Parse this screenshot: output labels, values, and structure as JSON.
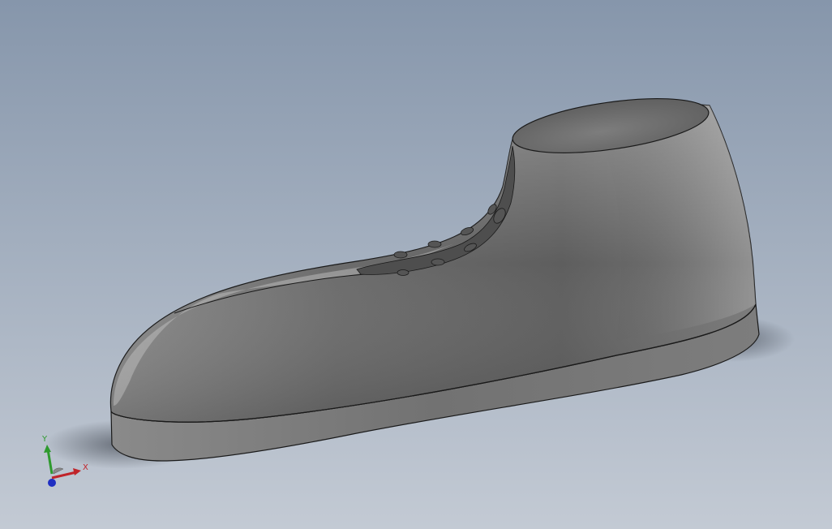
{
  "viewport": {
    "background_top": "#8696ab",
    "background_bottom": "#c3cad4",
    "model_color": "#6e6e6e"
  },
  "triad": {
    "x_label": "X",
    "y_label": "Y",
    "x_color": "#c0242a",
    "y_color": "#2e9a2e",
    "z_color": "#1f2fc2"
  }
}
